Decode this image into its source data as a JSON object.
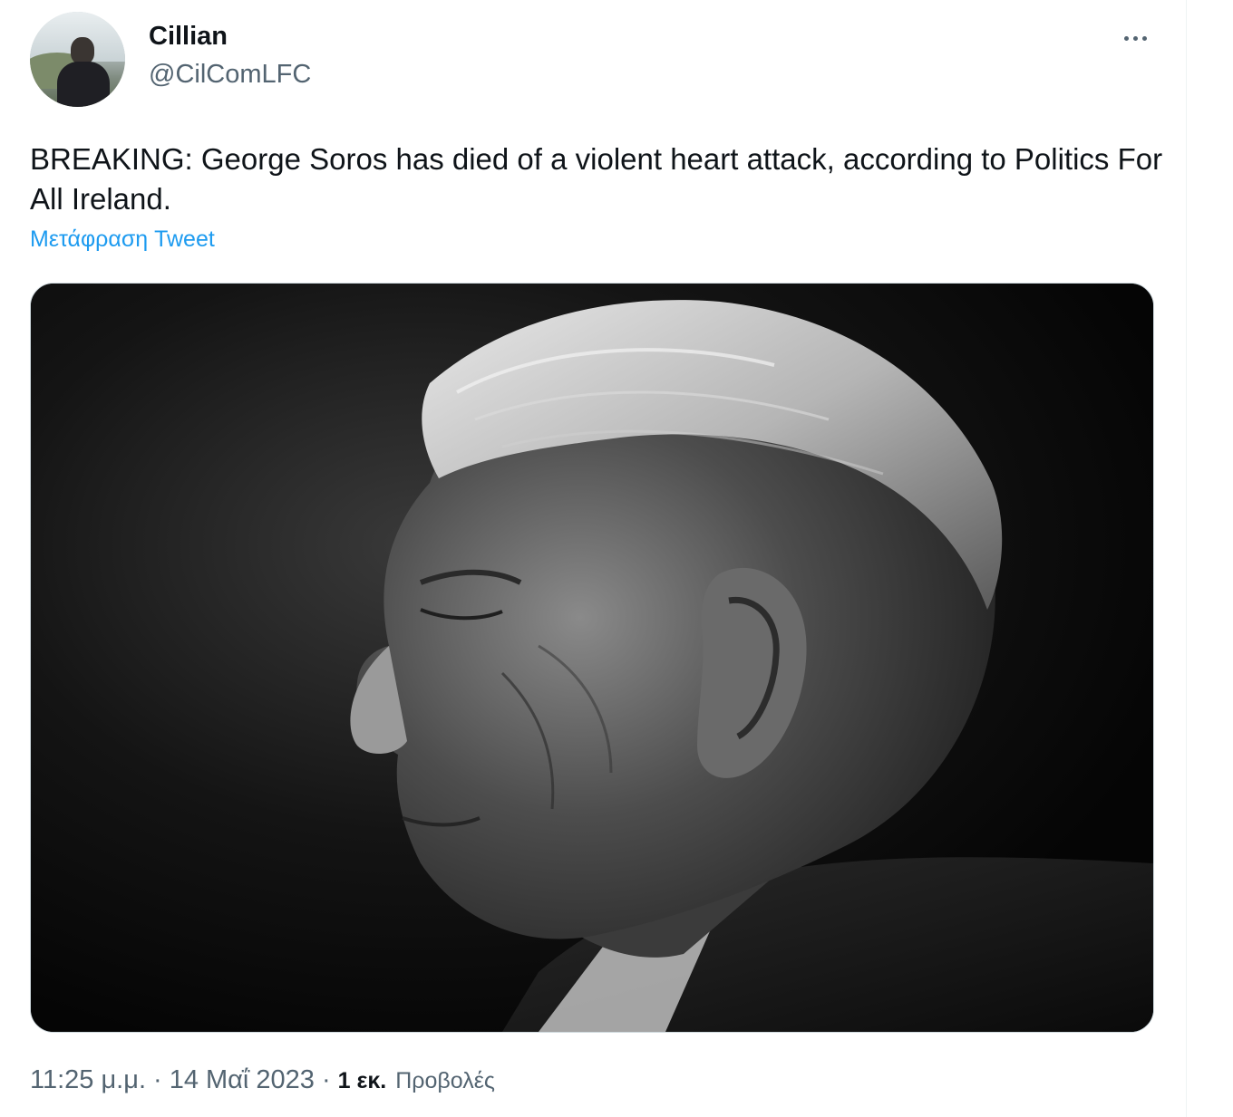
{
  "author": {
    "display_name": "Cillian",
    "handle": "@CilComLFC"
  },
  "tweet": {
    "text": "BREAKING: George Soros has died of a violent heart attack, according to Politics For All Ireland.",
    "translate_label": "Μετάφραση Tweet",
    "image_description_icon": "portrait-photo"
  },
  "meta": {
    "time": "11:25 μ.μ.",
    "date": "14 Μαΐ 2023",
    "separator": "·",
    "views_count": "1 εκ.",
    "views_label": "Προβολές"
  },
  "colors": {
    "link": "#1d9bf0",
    "secondary_text": "#536471",
    "primary_text": "#0f1419"
  }
}
